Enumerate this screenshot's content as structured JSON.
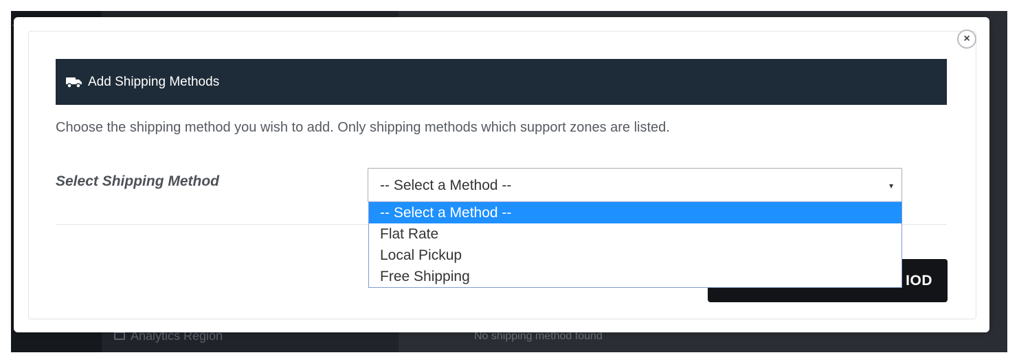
{
  "background": {
    "sidebar_item": "Analytics Region",
    "notice": "No shipping method found"
  },
  "modal": {
    "close_label": "×",
    "header": {
      "icon": "truck-icon",
      "title": "Add Shipping Methods"
    },
    "description": "Choose the shipping method you wish to add. Only shipping methods which support zones are listed.",
    "field_label": "Select Shipping Method",
    "select": {
      "value": "-- Select a Method --",
      "arrow": "▾",
      "options": [
        "-- Select a Method --",
        "Flat Rate",
        "Local Pickup",
        "Free Shipping"
      ],
      "highlighted_index": 0
    },
    "action_button_visible_text": "IOD"
  },
  "colors": {
    "header_bg": "#1e2b38",
    "option_highlight": "#1e90ff",
    "button_bg": "#121417"
  }
}
